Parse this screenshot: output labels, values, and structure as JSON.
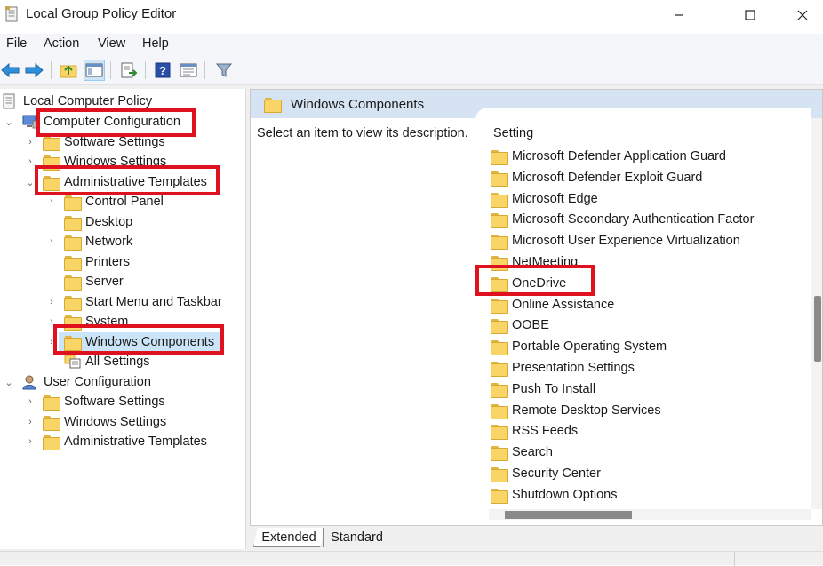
{
  "window": {
    "title": "Local Group Policy Editor",
    "app_icon": "policy-document-icon",
    "controls": [
      "minimize-icon",
      "maximize-icon",
      "close-icon"
    ]
  },
  "menu": [
    "File",
    "Action",
    "View",
    "Help"
  ],
  "toolbar": {
    "buttons": [
      "back-arrow-icon",
      "forward-arrow-icon",
      "up-folder-icon",
      "show-hide-tree-icon",
      "export-list-icon",
      "help-icon",
      "properties-view-icon",
      "filter-icon"
    ],
    "active": "show-hide-tree-icon"
  },
  "tree": {
    "root": "Local Computer Policy",
    "computer_configuration": "Computer Configuration",
    "cc_children": [
      "Software Settings",
      "Windows Settings",
      "Administrative Templates"
    ],
    "admin_templates_children": [
      "Control Panel",
      "Desktop",
      "Network",
      "Printers",
      "Server",
      "Start Menu and Taskbar",
      "System",
      "Windows Components",
      "All Settings"
    ],
    "user_configuration": "User Configuration",
    "uc_children": [
      "Software Settings",
      "Windows Settings",
      "Administrative Templates"
    ],
    "selected": "Windows Components"
  },
  "right_pane": {
    "header": "Windows Components",
    "description": "Select an item to view its description.",
    "column_header": "Setting",
    "items": [
      "Microsoft Defender Application Guard",
      "Microsoft Defender Exploit Guard",
      "Microsoft Edge",
      "Microsoft Secondary Authentication Factor",
      "Microsoft User Experience Virtualization",
      "NetMeeting",
      "OneDrive",
      "Online Assistance",
      "OOBE",
      "Portable Operating System",
      "Presentation Settings",
      "Push To Install",
      "Remote Desktop Services",
      "RSS Feeds",
      "Search",
      "Security Center",
      "Shutdown Options"
    ]
  },
  "tabs": [
    "Extended",
    "Standard"
  ],
  "active_tab": "Extended",
  "highlight_color": "#e0111f",
  "header_color": "#d6e3f2",
  "selection_color": "#cce4f7"
}
